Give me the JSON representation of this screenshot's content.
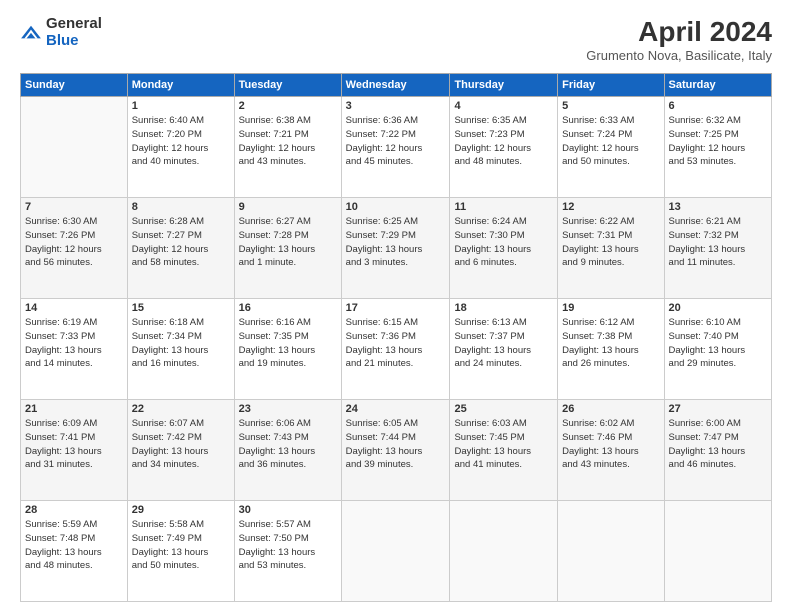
{
  "logo": {
    "general": "General",
    "blue": "Blue"
  },
  "header": {
    "month_year": "April 2024",
    "location": "Grumento Nova, Basilicate, Italy"
  },
  "days_of_week": [
    "Sunday",
    "Monday",
    "Tuesday",
    "Wednesday",
    "Thursday",
    "Friday",
    "Saturday"
  ],
  "weeks": [
    [
      {
        "day": "",
        "info": ""
      },
      {
        "day": "1",
        "info": "Sunrise: 6:40 AM\nSunset: 7:20 PM\nDaylight: 12 hours\nand 40 minutes."
      },
      {
        "day": "2",
        "info": "Sunrise: 6:38 AM\nSunset: 7:21 PM\nDaylight: 12 hours\nand 43 minutes."
      },
      {
        "day": "3",
        "info": "Sunrise: 6:36 AM\nSunset: 7:22 PM\nDaylight: 12 hours\nand 45 minutes."
      },
      {
        "day": "4",
        "info": "Sunrise: 6:35 AM\nSunset: 7:23 PM\nDaylight: 12 hours\nand 48 minutes."
      },
      {
        "day": "5",
        "info": "Sunrise: 6:33 AM\nSunset: 7:24 PM\nDaylight: 12 hours\nand 50 minutes."
      },
      {
        "day": "6",
        "info": "Sunrise: 6:32 AM\nSunset: 7:25 PM\nDaylight: 12 hours\nand 53 minutes."
      }
    ],
    [
      {
        "day": "7",
        "info": "Sunrise: 6:30 AM\nSunset: 7:26 PM\nDaylight: 12 hours\nand 56 minutes."
      },
      {
        "day": "8",
        "info": "Sunrise: 6:28 AM\nSunset: 7:27 PM\nDaylight: 12 hours\nand 58 minutes."
      },
      {
        "day": "9",
        "info": "Sunrise: 6:27 AM\nSunset: 7:28 PM\nDaylight: 13 hours\nand 1 minute."
      },
      {
        "day": "10",
        "info": "Sunrise: 6:25 AM\nSunset: 7:29 PM\nDaylight: 13 hours\nand 3 minutes."
      },
      {
        "day": "11",
        "info": "Sunrise: 6:24 AM\nSunset: 7:30 PM\nDaylight: 13 hours\nand 6 minutes."
      },
      {
        "day": "12",
        "info": "Sunrise: 6:22 AM\nSunset: 7:31 PM\nDaylight: 13 hours\nand 9 minutes."
      },
      {
        "day": "13",
        "info": "Sunrise: 6:21 AM\nSunset: 7:32 PM\nDaylight: 13 hours\nand 11 minutes."
      }
    ],
    [
      {
        "day": "14",
        "info": "Sunrise: 6:19 AM\nSunset: 7:33 PM\nDaylight: 13 hours\nand 14 minutes."
      },
      {
        "day": "15",
        "info": "Sunrise: 6:18 AM\nSunset: 7:34 PM\nDaylight: 13 hours\nand 16 minutes."
      },
      {
        "day": "16",
        "info": "Sunrise: 6:16 AM\nSunset: 7:35 PM\nDaylight: 13 hours\nand 19 minutes."
      },
      {
        "day": "17",
        "info": "Sunrise: 6:15 AM\nSunset: 7:36 PM\nDaylight: 13 hours\nand 21 minutes."
      },
      {
        "day": "18",
        "info": "Sunrise: 6:13 AM\nSunset: 7:37 PM\nDaylight: 13 hours\nand 24 minutes."
      },
      {
        "day": "19",
        "info": "Sunrise: 6:12 AM\nSunset: 7:38 PM\nDaylight: 13 hours\nand 26 minutes."
      },
      {
        "day": "20",
        "info": "Sunrise: 6:10 AM\nSunset: 7:40 PM\nDaylight: 13 hours\nand 29 minutes."
      }
    ],
    [
      {
        "day": "21",
        "info": "Sunrise: 6:09 AM\nSunset: 7:41 PM\nDaylight: 13 hours\nand 31 minutes."
      },
      {
        "day": "22",
        "info": "Sunrise: 6:07 AM\nSunset: 7:42 PM\nDaylight: 13 hours\nand 34 minutes."
      },
      {
        "day": "23",
        "info": "Sunrise: 6:06 AM\nSunset: 7:43 PM\nDaylight: 13 hours\nand 36 minutes."
      },
      {
        "day": "24",
        "info": "Sunrise: 6:05 AM\nSunset: 7:44 PM\nDaylight: 13 hours\nand 39 minutes."
      },
      {
        "day": "25",
        "info": "Sunrise: 6:03 AM\nSunset: 7:45 PM\nDaylight: 13 hours\nand 41 minutes."
      },
      {
        "day": "26",
        "info": "Sunrise: 6:02 AM\nSunset: 7:46 PM\nDaylight: 13 hours\nand 43 minutes."
      },
      {
        "day": "27",
        "info": "Sunrise: 6:00 AM\nSunset: 7:47 PM\nDaylight: 13 hours\nand 46 minutes."
      }
    ],
    [
      {
        "day": "28",
        "info": "Sunrise: 5:59 AM\nSunset: 7:48 PM\nDaylight: 13 hours\nand 48 minutes."
      },
      {
        "day": "29",
        "info": "Sunrise: 5:58 AM\nSunset: 7:49 PM\nDaylight: 13 hours\nand 50 minutes."
      },
      {
        "day": "30",
        "info": "Sunrise: 5:57 AM\nSunset: 7:50 PM\nDaylight: 13 hours\nand 53 minutes."
      },
      {
        "day": "",
        "info": ""
      },
      {
        "day": "",
        "info": ""
      },
      {
        "day": "",
        "info": ""
      },
      {
        "day": "",
        "info": ""
      }
    ]
  ]
}
